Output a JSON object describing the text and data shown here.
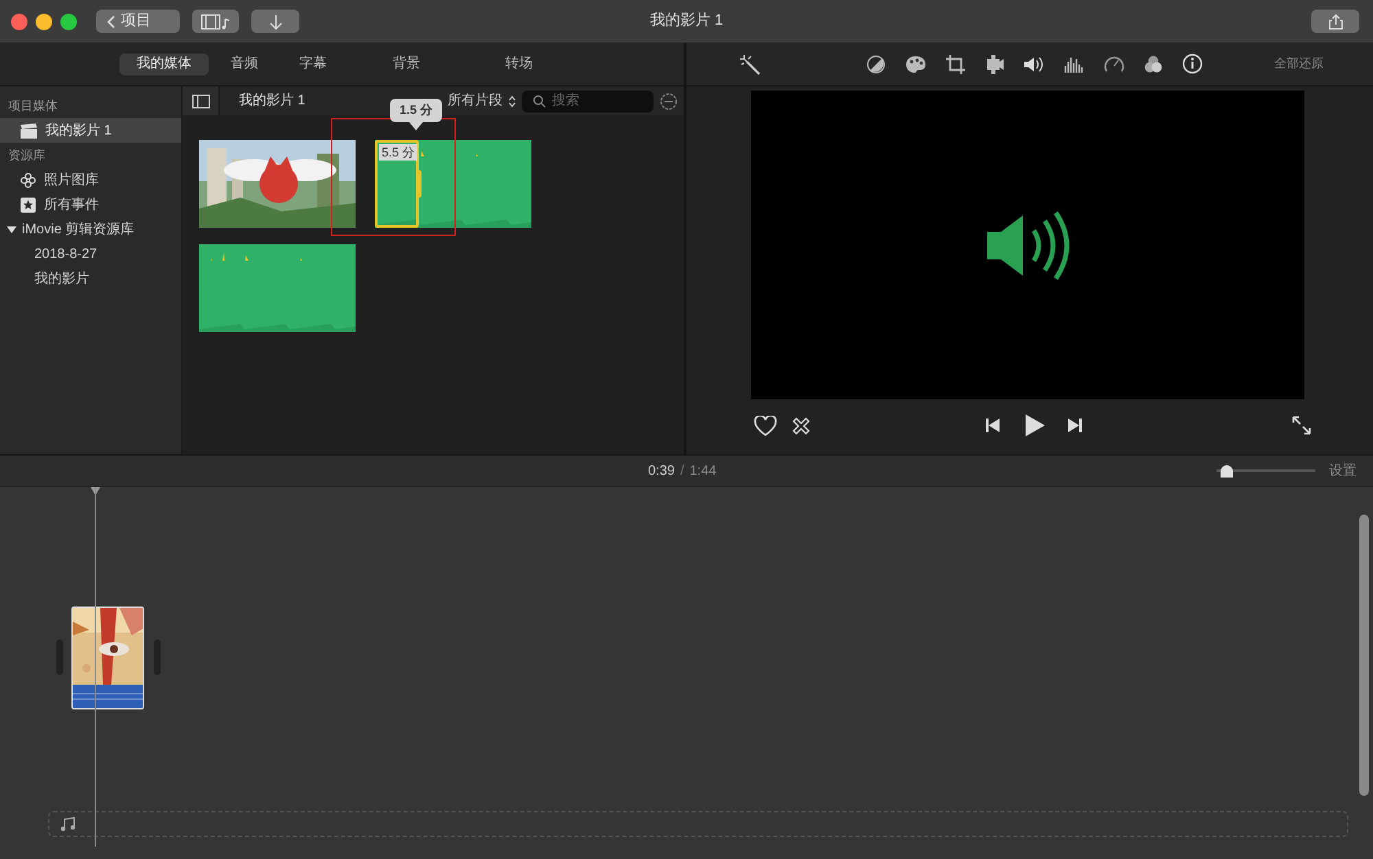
{
  "window": {
    "title": "我的影片 1"
  },
  "toolbar": {
    "back_button": "项目"
  },
  "media_tabs": [
    {
      "label": "我的媒体",
      "selected": true
    },
    {
      "label": "音频",
      "selected": false
    },
    {
      "label": "字幕",
      "selected": false
    },
    {
      "label": "背景",
      "selected": false
    },
    {
      "label": "转场",
      "selected": false
    }
  ],
  "sidebar": [
    {
      "kind": "heading",
      "label": "项目媒体"
    },
    {
      "kind": "item",
      "label": "我的影片 1",
      "selected": true
    },
    {
      "kind": "heading",
      "label": "资源库"
    },
    {
      "kind": "item",
      "label": "照片图库",
      "selected": false
    },
    {
      "kind": "item",
      "label": "所有事件",
      "selected": false
    },
    {
      "kind": "library",
      "label": "iMovie 剪辑资源库",
      "expanded": true,
      "children": [
        {
          "label": "2018-8-27"
        },
        {
          "label": "我的影片"
        }
      ]
    }
  ],
  "browser": {
    "title": "我的影片 1",
    "filter": "所有片段",
    "search": {
      "placeholder": "搜索"
    },
    "clips": [
      {
        "kind": "video"
      },
      {
        "kind": "audio",
        "range_label": "5.5 分",
        "tooltip": "1.5 分"
      },
      {
        "kind": "audio"
      }
    ]
  },
  "viewer": {
    "reset_button": "全部还原"
  },
  "timeline": {
    "current_time": "0:39",
    "separator": "/",
    "duration": "1:44",
    "zoom": {
      "level": 0.05
    },
    "settings_button": "设置"
  }
}
